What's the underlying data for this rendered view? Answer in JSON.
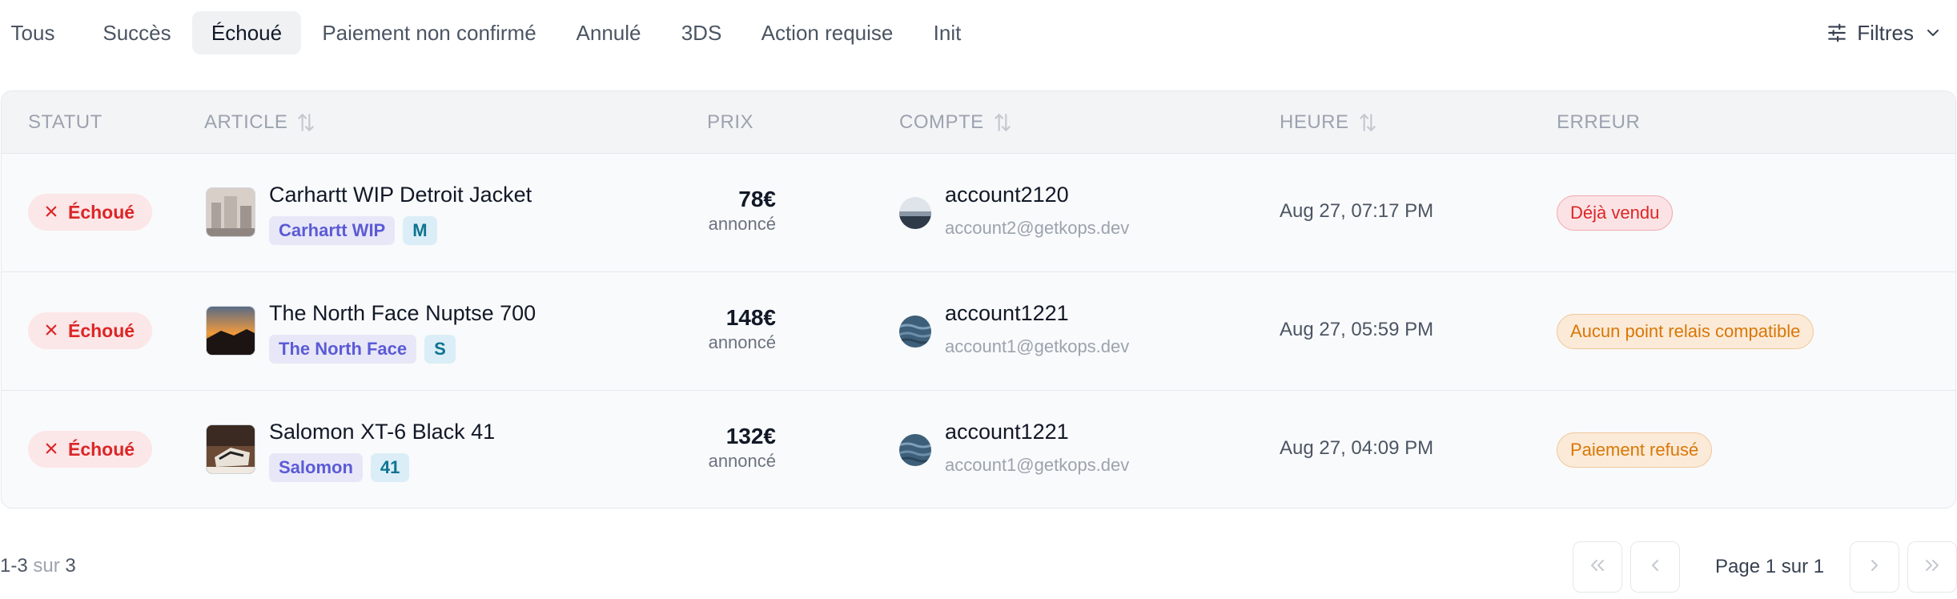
{
  "tabs": [
    {
      "label": "Tous",
      "active": false
    },
    {
      "label": "Succès",
      "active": false
    },
    {
      "label": "Échoué",
      "active": true
    },
    {
      "label": "Paiement non confirmé",
      "active": false
    },
    {
      "label": "Annulé",
      "active": false
    },
    {
      "label": "3DS",
      "active": false
    },
    {
      "label": "Action requise",
      "active": false
    },
    {
      "label": "Init",
      "active": false
    }
  ],
  "filters": {
    "label": "Filtres",
    "icon": "sliders-icon"
  },
  "table": {
    "headers": {
      "statut": "STATUT",
      "article": "ARTICLE",
      "prix": "PRIX",
      "compte": "COMPTE",
      "heure": "HEURE",
      "erreur": "ERREUR"
    },
    "rows": [
      {
        "status": "Échoué",
        "item": {
          "name": "Carhartt WIP Detroit Jacket",
          "brand": "Carhartt WIP",
          "size": "M"
        },
        "price": {
          "value": "78€",
          "sub": "annoncé"
        },
        "account": {
          "name": "account2120",
          "email": "account2@getkops.dev"
        },
        "time": "Aug 27, 07:17 PM",
        "error": {
          "text": "Déjà vendu",
          "tone": "red"
        }
      },
      {
        "status": "Échoué",
        "item": {
          "name": "The North Face Nuptse 700",
          "brand": "The North Face",
          "size": "S"
        },
        "price": {
          "value": "148€",
          "sub": "annoncé"
        },
        "account": {
          "name": "account1221",
          "email": "account1@getkops.dev"
        },
        "time": "Aug 27, 05:59 PM",
        "error": {
          "text": "Aucun point relais compatible",
          "tone": "orange"
        }
      },
      {
        "status": "Échoué",
        "item": {
          "name": "Salomon XT-6 Black 41",
          "brand": "Salomon",
          "size": "41"
        },
        "price": {
          "value": "132€",
          "sub": "annoncé"
        },
        "account": {
          "name": "account1221",
          "email": "account1@getkops.dev"
        },
        "time": "Aug 27, 04:09 PM",
        "error": {
          "text": "Paiement refusé",
          "tone": "orange"
        }
      }
    ]
  },
  "footer": {
    "range": "1-3",
    "of": "sur",
    "total": "3",
    "page_label": "Page 1 sur 1"
  },
  "colors": {
    "accent_brand": "#5b5bd6",
    "status_failed": "#dc2626",
    "warning": "#d97706"
  }
}
